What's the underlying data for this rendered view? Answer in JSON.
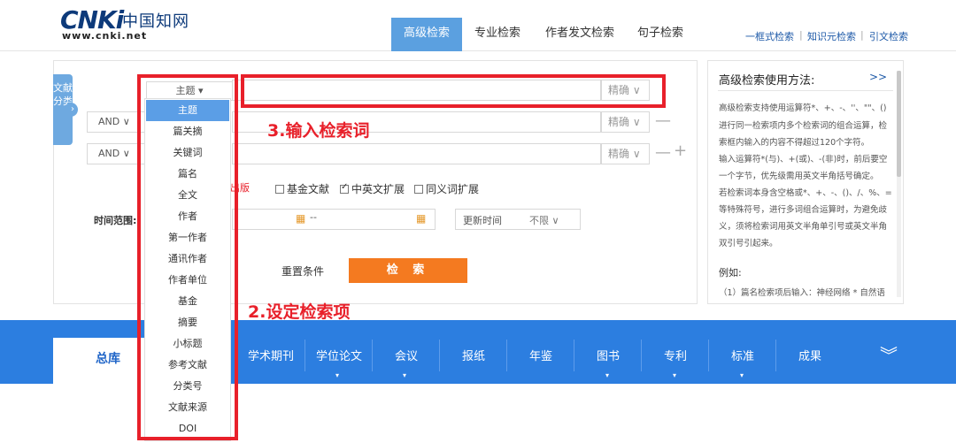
{
  "header": {
    "logo_text": "CNKi",
    "logo_cn": "中国知网",
    "logo_url": "www.cnki.net",
    "tabs": [
      {
        "label": "高级检索",
        "active": true
      },
      {
        "label": "专业检索",
        "active": false
      },
      {
        "label": "作者发文检索",
        "active": false
      },
      {
        "label": "句子检索",
        "active": false
      }
    ],
    "links": [
      "一框式检索",
      "知识元检索",
      "引文检索"
    ],
    "link_sep": "|"
  },
  "panel": {
    "category_tab": "文献分类",
    "field_select": "主题 ▾",
    "logic": [
      "AND ∨",
      "AND ∨"
    ],
    "precise": [
      "精确 ∨",
      "精确 ∨",
      "精确 ∨"
    ],
    "minus": "—",
    "plus": "+",
    "partial_text": "出版",
    "checkboxes": [
      {
        "label": "基金文献",
        "checked": false
      },
      {
        "label": "中英文扩展",
        "checked": true
      },
      {
        "label": "同义词扩展",
        "checked": false
      }
    ],
    "time_label": "时间范围:",
    "date_sep": "--",
    "update_label": "更新时间",
    "update_value": "不限 ∨",
    "reset": "重置条件",
    "search": "检 索"
  },
  "help": {
    "title": "高级检索使用方法:",
    "more": ">>",
    "lines": [
      "高级检索支持使用运算符*、+、-、''、\"\"、()",
      "进行同一检索项内多个检索词的组合运算，检",
      "索框内输入的内容不得超过120个字符。",
      "输入运算符*(与)、+(或)、-(非)时，前后要空",
      "一个字节，优先级需用英文半角括号确定。",
      "若检索词本身含空格或*、+、-、()、/、%、=",
      "等特殊符号，进行多词组合运算时，为避免歧",
      "义，须将检索词用英文半角单引号或英文半角",
      "双引号引起来。"
    ],
    "example_title": "例如:",
    "example_line": "（1）篇名检索项后输入：神经网络 * 自然语"
  },
  "nav": {
    "home": "总库",
    "items": [
      "学术期刊",
      "学位论文",
      "会议",
      "报纸",
      "年鉴",
      "图书",
      "专利",
      "标准",
      "成果"
    ],
    "caret": "▾",
    "chevron": "︾"
  },
  "dropdown": {
    "items": [
      "主题",
      "篇关摘",
      "关键词",
      "篇名",
      "全文",
      "作者",
      "第一作者",
      "通讯作者",
      "作者单位",
      "基金",
      "摘要",
      "小标题",
      "参考文献",
      "分类号",
      "文献来源",
      "DOI"
    ],
    "selected_index": 0
  },
  "annotations": {
    "step3": "3.输入检索词",
    "step2": "2.设定检索项"
  },
  "colors": {
    "accent_blue": "#2c7ee0",
    "tab_blue": "#5ba0e0",
    "search_orange": "#f47a20",
    "annotation_red": "#e8202a"
  }
}
